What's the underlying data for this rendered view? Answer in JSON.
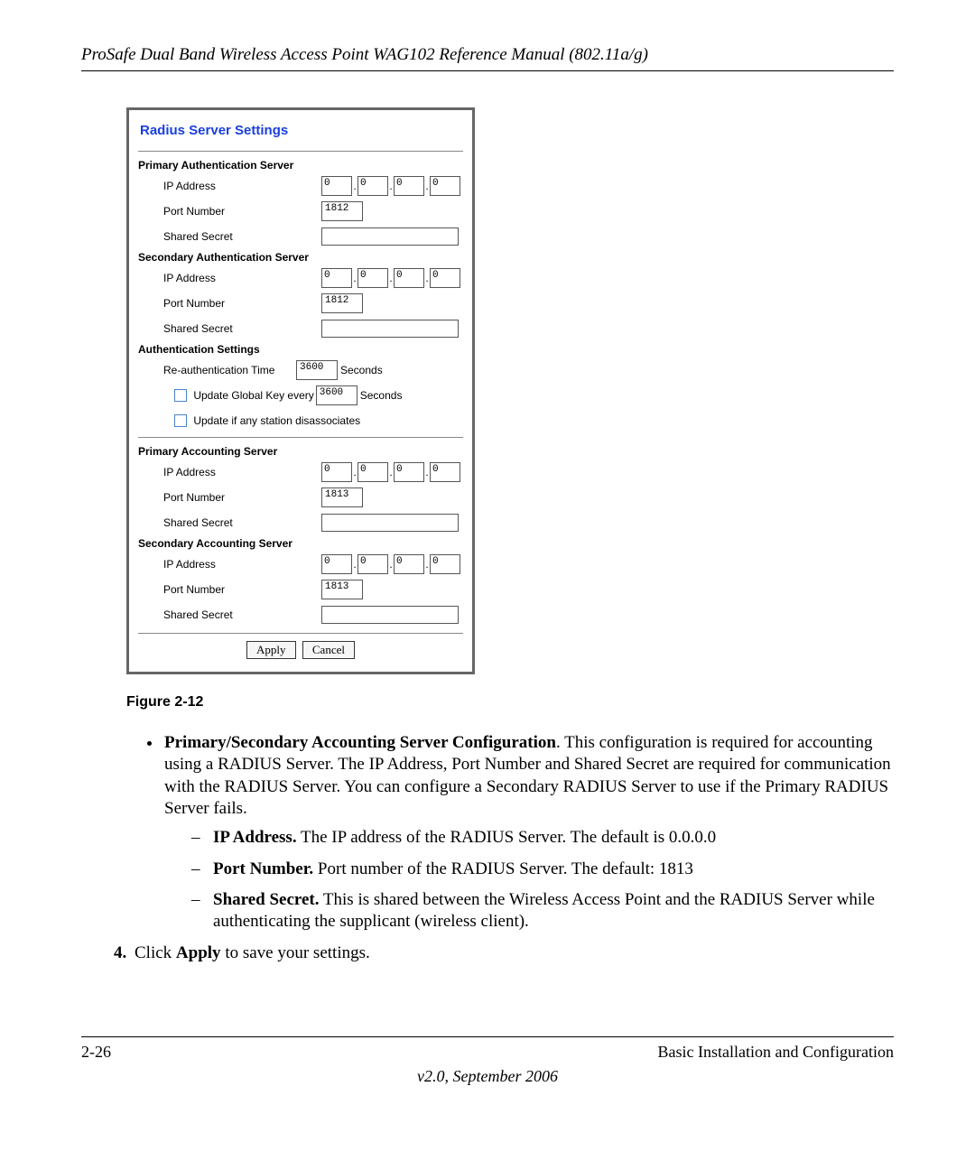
{
  "header_title": "ProSafe Dual Band Wireless Access Point WAG102 Reference Manual (802.11a/g)",
  "panel": {
    "title": "Radius Server Settings",
    "groups": {
      "primary_auth": {
        "heading": "Primary Authentication Server",
        "ip_label": "IP Address",
        "ip": [
          "0",
          "0",
          "0",
          "0"
        ],
        "port_label": "Port Number",
        "port": "1812",
        "secret_label": "Shared Secret",
        "secret": ""
      },
      "secondary_auth": {
        "heading": "Secondary Authentication Server",
        "ip_label": "IP Address",
        "ip": [
          "0",
          "0",
          "0",
          "0"
        ],
        "port_label": "Port Number",
        "port": "1812",
        "secret_label": "Shared Secret",
        "secret": ""
      },
      "auth_settings": {
        "heading": "Authentication Settings",
        "reauth_label": "Re-authentication Time",
        "reauth_value": "3600",
        "seconds": "Seconds",
        "update_key_label": "Update Global Key every",
        "update_key_value": "3600",
        "update_disassoc_label": "Update if any station disassociates"
      },
      "primary_acct": {
        "heading": "Primary Accounting Server",
        "ip_label": "IP Address",
        "ip": [
          "0",
          "0",
          "0",
          "0"
        ],
        "port_label": "Port Number",
        "port": "1813",
        "secret_label": "Shared Secret",
        "secret": ""
      },
      "secondary_acct": {
        "heading": "Secondary Accounting Server",
        "ip_label": "IP Address",
        "ip": [
          "0",
          "0",
          "0",
          "0"
        ],
        "port_label": "Port Number",
        "port": "1813",
        "secret_label": "Shared Secret",
        "secret": ""
      }
    },
    "buttons": {
      "apply": "Apply",
      "cancel": "Cancel"
    }
  },
  "figure_caption": "Figure 2-12",
  "body": {
    "bullet_lead_bold": "Primary/Secondary Accounting Server Configuration",
    "bullet_lead_rest": ". This configuration is required for accounting using a RADIUS Server. The IP Address, Port Number and Shared Secret are required for communication with the RADIUS Server. You can configure a Secondary RADIUS Server to use if the Primary RADIUS Server fails.",
    "sub1_bold": "IP Address.",
    "sub1_rest": " The IP address of the RADIUS Server. The default is 0.0.0.0",
    "sub2_bold": "Port Number.",
    "sub2_rest": " Port number of the RADIUS Server. The default: 1813",
    "sub3_bold": "Shared Secret.",
    "sub3_rest": " This is shared between the Wireless Access Point and the RADIUS Server while authenticating the supplicant (wireless client).",
    "step4_pre": "Click ",
    "step4_bold": "Apply",
    "step4_post": " to save your settings."
  },
  "footer": {
    "page": "2-26",
    "section": "Basic Installation and Configuration",
    "version": "v2.0, September 2006"
  }
}
